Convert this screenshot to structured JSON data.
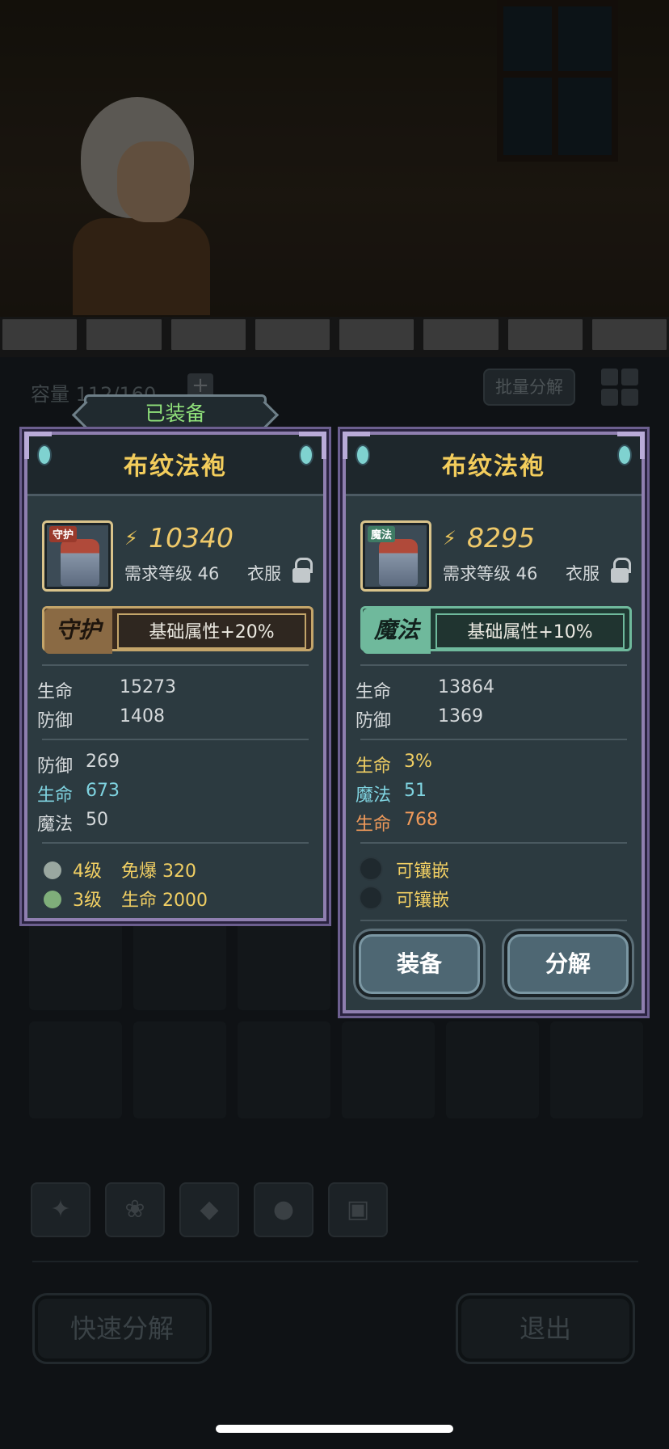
{
  "inventory": {
    "capacity": "容量 112/160",
    "batch_decompose": "批量分解",
    "quick_decompose": "快速分解",
    "exit": "退出"
  },
  "equipped_label": "已装备",
  "left_card": {
    "title": "布纹法袍",
    "icon_tag": "守护",
    "power": "10340",
    "required_level": "需求等级 46",
    "slot": "衣服",
    "quality_badge": "守护",
    "quality_bonus": "基础属性+20%",
    "base_stats": [
      {
        "label": "生命",
        "value": "15273"
      },
      {
        "label": "防御",
        "value": "1408"
      }
    ],
    "extra_stats": [
      {
        "label": "防御",
        "value": "269",
        "color": "#d5d9db"
      },
      {
        "label": "生命",
        "value": "673",
        "color": "#7fd3e0"
      },
      {
        "label": "魔法",
        "value": "50",
        "color": "#d5d9db"
      }
    ],
    "gems": [
      {
        "level": "4级",
        "text": "免爆 320"
      },
      {
        "level": "3级",
        "text": "生命 2000"
      }
    ]
  },
  "right_card": {
    "title": "布纹法袍",
    "icon_tag": "魔法",
    "power": "8295",
    "required_level": "需求等级 46",
    "slot": "衣服",
    "quality_badge": "魔法",
    "quality_bonus": "基础属性+10%",
    "base_stats": [
      {
        "label": "生命",
        "value": "13864"
      },
      {
        "label": "防御",
        "value": "1369"
      }
    ],
    "extra_stats": [
      {
        "label": "生命",
        "value": "3%",
        "color": "#f1cf63"
      },
      {
        "label": "魔法",
        "value": "51",
        "color": "#7fd3e0"
      },
      {
        "label": "生命",
        "value": "768",
        "color": "#f09a5a"
      }
    ],
    "sockets": [
      "可镶嵌",
      "可镶嵌"
    ],
    "equip_button": "装备",
    "decompose_button": "分解"
  }
}
